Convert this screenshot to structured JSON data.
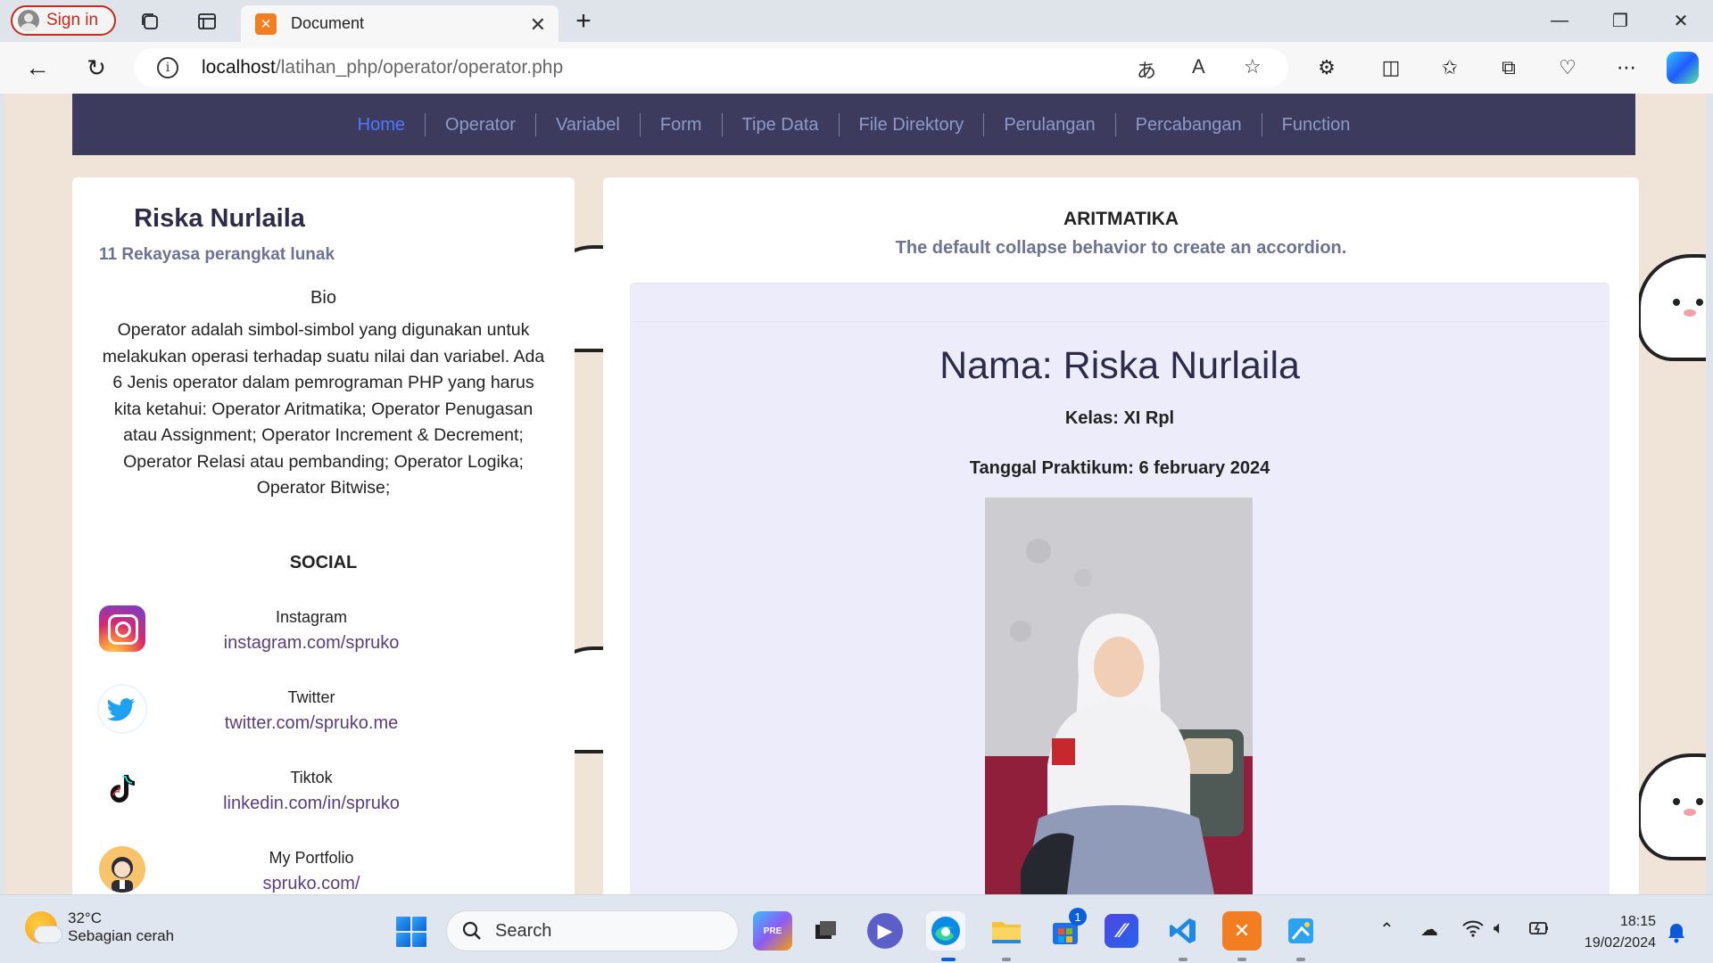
{
  "browser": {
    "signin_label": "Sign in",
    "tab_title": "Document",
    "url_host": "localhost",
    "url_path": "/latihan_php/operator/operator.php"
  },
  "nav": {
    "items": [
      "Home",
      "Operator",
      "Variabel",
      "Form",
      "Tipe Data",
      "File Direktory",
      "Perulangan",
      "Percabangan",
      "Function"
    ],
    "active": "Home"
  },
  "profile": {
    "name": "Riska Nurlaila",
    "class_subtitle": "11 Rekayasa perangkat lunak",
    "bio_title": "Bio",
    "bio_text": "Operator adalah simbol-simbol yang digunakan untuk melakukan operasi terhadap suatu nilai dan variabel. Ada 6 Jenis operator dalam pemrograman PHP yang harus kita ketahui: Operator Aritmatika; Operator Penugasan atau Assignment; Operator Increment & Decrement; Operator Relasi atau pembanding; Operator Logika; Operator Bitwise;",
    "social_title": "SOCIAL",
    "social": [
      {
        "label": "Instagram",
        "link": "instagram.com/spruko",
        "icon": "instagram-icon"
      },
      {
        "label": "Twitter",
        "link": "twitter.com/spruko.me",
        "icon": "twitter-icon"
      },
      {
        "label": "Tiktok",
        "link": "linkedin.com/in/spruko",
        "icon": "tiktok-icon"
      },
      {
        "label": "My Portfolio",
        "link": "spruko.com/",
        "icon": "portfolio-avatar-icon"
      }
    ]
  },
  "main": {
    "heading": "ARITMATIKA",
    "subheading": "The default collapse behavior to create an accordion.",
    "nama": "Nama: Riska Nurlaila",
    "kelas": "Kelas: XI Rpl",
    "tanggal": "Tanggal Praktikum: 6 february 2024"
  },
  "taskbar": {
    "temperature": "32°C",
    "weather_desc": "Sebagian cerah",
    "search_placeholder": "Search",
    "time": "18:15",
    "date": "19/02/2024",
    "store_badge": "1"
  },
  "colors": {
    "navbar_bg": "#3d3b5d",
    "nav_active": "#4d79ff",
    "accordion_bg": "#ececfb",
    "link": "#5b3d7c"
  }
}
